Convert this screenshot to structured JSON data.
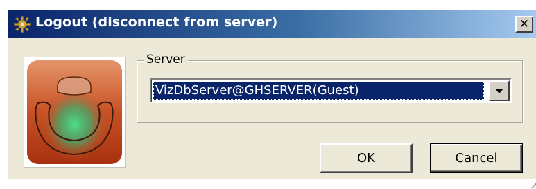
{
  "window": {
    "title": "Logout (disconnect from server)",
    "close_label": "✕",
    "title_icon": "gear-logo-icon",
    "close_icon": "close-icon"
  },
  "logo": {
    "icon": "app-logo-icon",
    "colors": {
      "outer": "#c0441e",
      "inner_glow": "#3ccf7a"
    }
  },
  "server_group": {
    "label": "Server",
    "selected_server": "VizDbServer@GHSERVER(Guest)",
    "dropdown_icon": "chevron-down-icon"
  },
  "buttons": {
    "ok_label": "OK",
    "cancel_label": "Cancel"
  },
  "colors": {
    "title_bar_start": "#0a246a",
    "title_bar_end": "#a6caf0",
    "dialog_bg": "#ece9d8",
    "selection_bg": "#0a246a"
  }
}
